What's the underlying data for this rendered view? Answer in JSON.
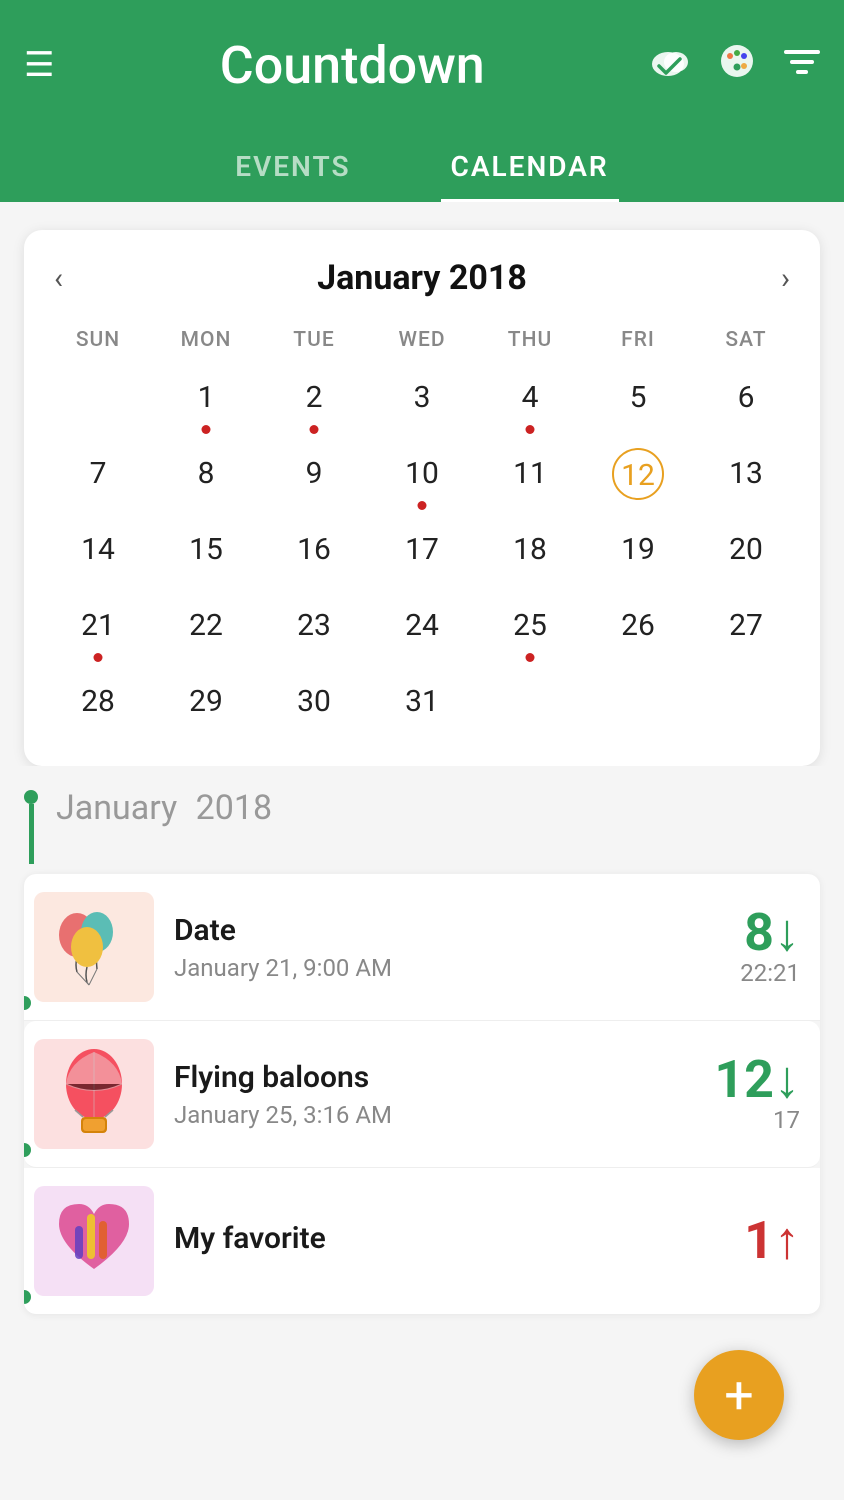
{
  "header": {
    "title": "Countdown",
    "menu_icon": "☰",
    "check_icon": "✔",
    "palette_icon": "🎨",
    "filter_icon": "☰"
  },
  "tabs": [
    {
      "label": "EVENTS",
      "active": false
    },
    {
      "label": "CALENDAR",
      "active": true
    }
  ],
  "calendar": {
    "month_title": "January 2018",
    "prev_label": "‹",
    "next_label": "›",
    "weekdays": [
      "SUN",
      "MON",
      "TUE",
      "WED",
      "THU",
      "FRI",
      "SAT"
    ],
    "weeks": [
      [
        {
          "day": "",
          "dot": false
        },
        {
          "day": "1",
          "dot": true
        },
        {
          "day": "2",
          "dot": true
        },
        {
          "day": "3",
          "dot": false
        },
        {
          "day": "4",
          "dot": true
        },
        {
          "day": "5",
          "dot": false
        },
        {
          "day": "6",
          "dot": false
        }
      ],
      [
        {
          "day": "7",
          "dot": false
        },
        {
          "day": "8",
          "dot": false
        },
        {
          "day": "9",
          "dot": false
        },
        {
          "day": "10",
          "dot": true
        },
        {
          "day": "11",
          "dot": false
        },
        {
          "day": "12",
          "dot": false,
          "today": true
        },
        {
          "day": "13",
          "dot": false
        }
      ],
      [
        {
          "day": "14",
          "dot": false
        },
        {
          "day": "15",
          "dot": false
        },
        {
          "day": "16",
          "dot": false
        },
        {
          "day": "17",
          "dot": false
        },
        {
          "day": "18",
          "dot": false
        },
        {
          "day": "19",
          "dot": false
        },
        {
          "day": "20",
          "dot": false
        }
      ],
      [
        {
          "day": "21",
          "dot": true
        },
        {
          "day": "22",
          "dot": false
        },
        {
          "day": "23",
          "dot": false
        },
        {
          "day": "24",
          "dot": false
        },
        {
          "day": "25",
          "dot": true
        },
        {
          "day": "26",
          "dot": false
        },
        {
          "day": "27",
          "dot": false
        }
      ],
      [
        {
          "day": "28",
          "dot": false
        },
        {
          "day": "29",
          "dot": false
        },
        {
          "day": "30",
          "dot": false
        },
        {
          "day": "31",
          "dot": false
        },
        {
          "day": "",
          "dot": false
        },
        {
          "day": "",
          "dot": false
        },
        {
          "day": "",
          "dot": false
        }
      ]
    ]
  },
  "events_section": {
    "month_label": "January",
    "year_label": "2018",
    "events": [
      {
        "id": "date",
        "name": "Date",
        "date_str": "January 21, 9:00 AM",
        "count": "8",
        "count_dir": "↓",
        "time_left": "22:21",
        "thumb_type": "balloons"
      },
      {
        "id": "flying-baloons",
        "name": "Flying baloons",
        "date_str": "January 25, 3:16 AM",
        "count": "12",
        "count_dir": "↓",
        "time_left": "17",
        "thumb_type": "hotair"
      },
      {
        "id": "my-favorite",
        "name": "My favorite",
        "date_str": "",
        "count": "1",
        "count_dir": "↑",
        "time_left": "",
        "thumb_type": "heart"
      }
    ]
  },
  "fab": {
    "label": "+"
  }
}
